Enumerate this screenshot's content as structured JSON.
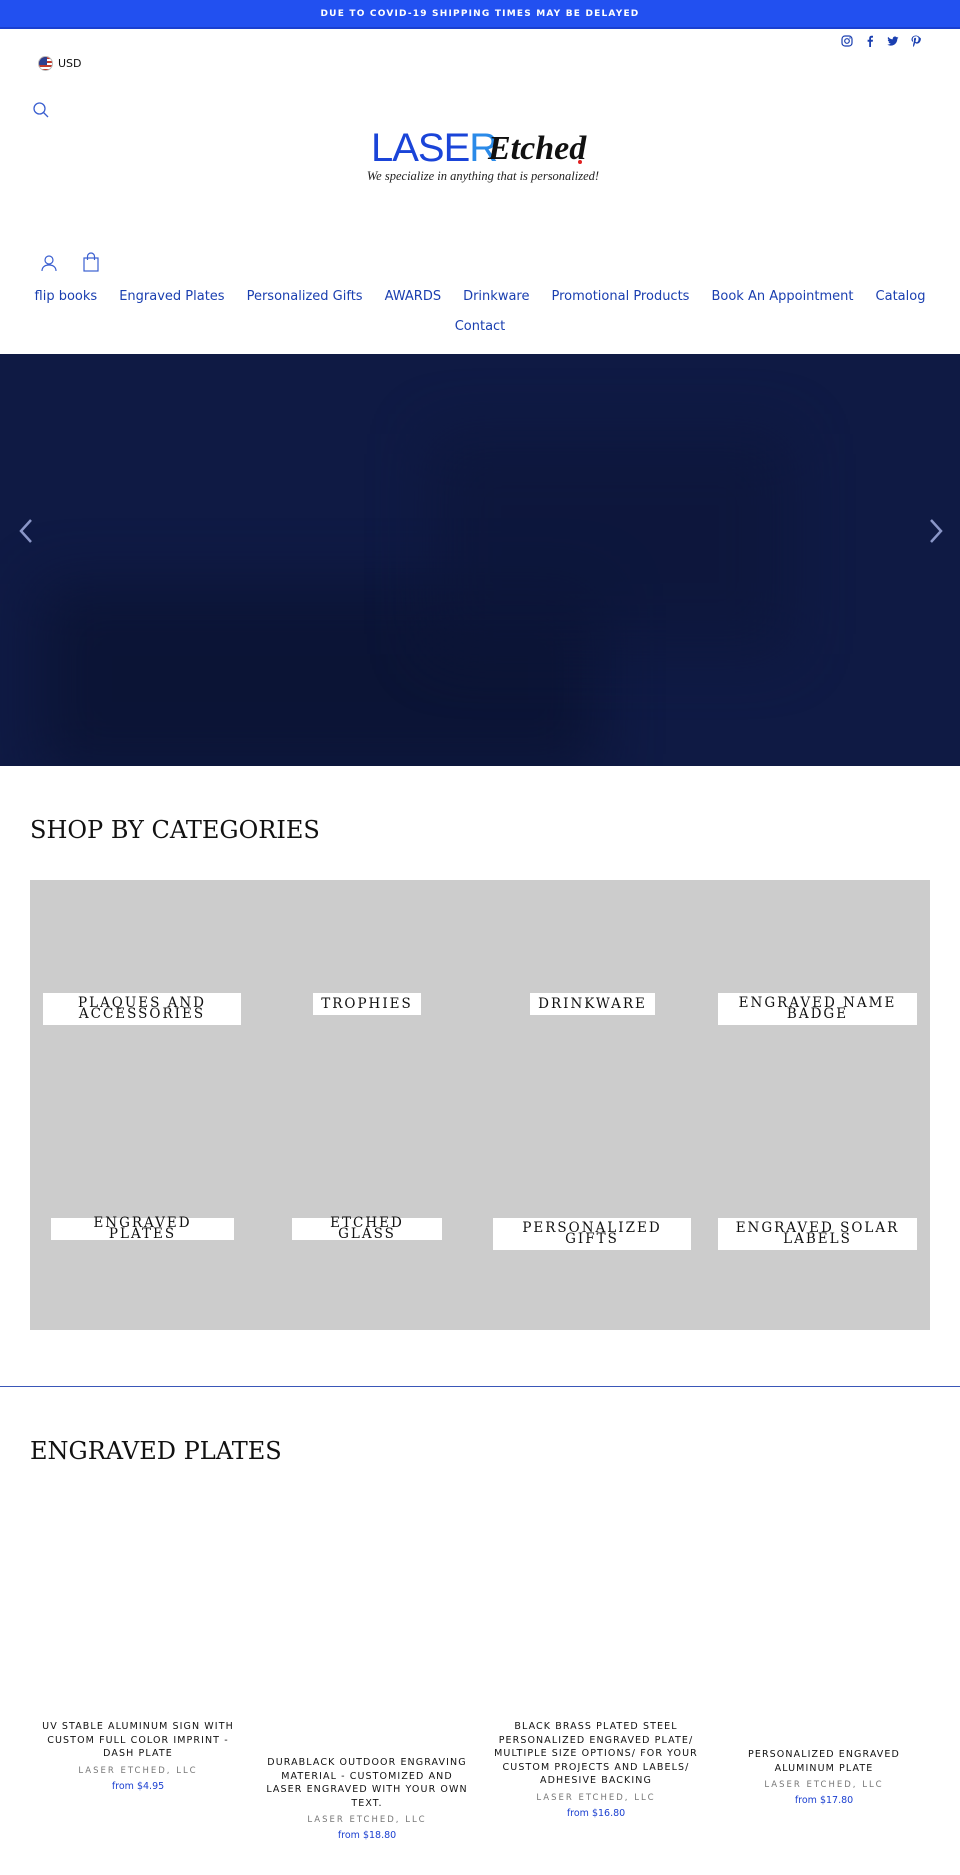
{
  "announcement": "DUE TO COVID-19 SHIPPING TIMES MAY BE DELAYED",
  "social_icons": [
    "instagram-icon",
    "facebook-icon",
    "twitter-icon",
    "pinterest-icon"
  ],
  "currency": {
    "code": "USD",
    "flag": "us-flag-icon"
  },
  "logo": {
    "laser_dark": "LASE",
    "laser_light": "R",
    "etched": "Etched",
    "tagline": "We specialize in anything that is personalized!"
  },
  "nav": {
    "items": [
      "flip books",
      "Engraved Plates",
      "Personalized Gifts",
      "AWARDS",
      "Drinkware",
      "Promotional Products",
      "Book An Appointment",
      "Catalog",
      "Contact"
    ]
  },
  "categories": {
    "heading": "SHOP BY CATEGORIES",
    "items": [
      "PLAQUES AND ACCESSORIES",
      "TROPHIES",
      "DRINKWARE",
      "ENGRAVED NAME BADGE",
      "ENGRAVED PLATES",
      "ETCHED GLASS",
      "PERSONALIZED GIFTS",
      "ENGRAVED SOLAR LABELS"
    ]
  },
  "engraved_plates": {
    "heading": "ENGRAVED PLATES",
    "products": [
      {
        "title": "UV STABLE ALUMINUM SIGN WITH CUSTOM FULL COLOR IMPRINT - DASH PLATE",
        "vendor": "LASER ETCHED, LLC",
        "price": "from $4.95"
      },
      {
        "title": "DURABLACK OUTDOOR ENGRAVING MATERIAL - CUSTOMIZED AND LASER ENGRAVED WITH YOUR OWN TEXT.",
        "vendor": "LASER ETCHED, LLC",
        "price": "from $18.80"
      },
      {
        "title": "BLACK BRASS PLATED STEEL PERSONALIZED ENGRAVED PLATE/ MULTIPLE SIZE OPTIONS/ FOR YOUR CUSTOM PROJECTS AND LABELS/ ADHESIVE BACKING",
        "vendor": "LASER ETCHED, LLC",
        "price": "from $16.80"
      },
      {
        "title": "PERSONALIZED ENGRAVED ALUMINUM PLATE",
        "vendor": "LASER ETCHED, LLC",
        "price": "from $17.80"
      }
    ]
  },
  "colors": {
    "accent": "#2250f0",
    "link": "#1a3fb0",
    "hero": "#0f1a44",
    "tile": "#cccccc"
  }
}
